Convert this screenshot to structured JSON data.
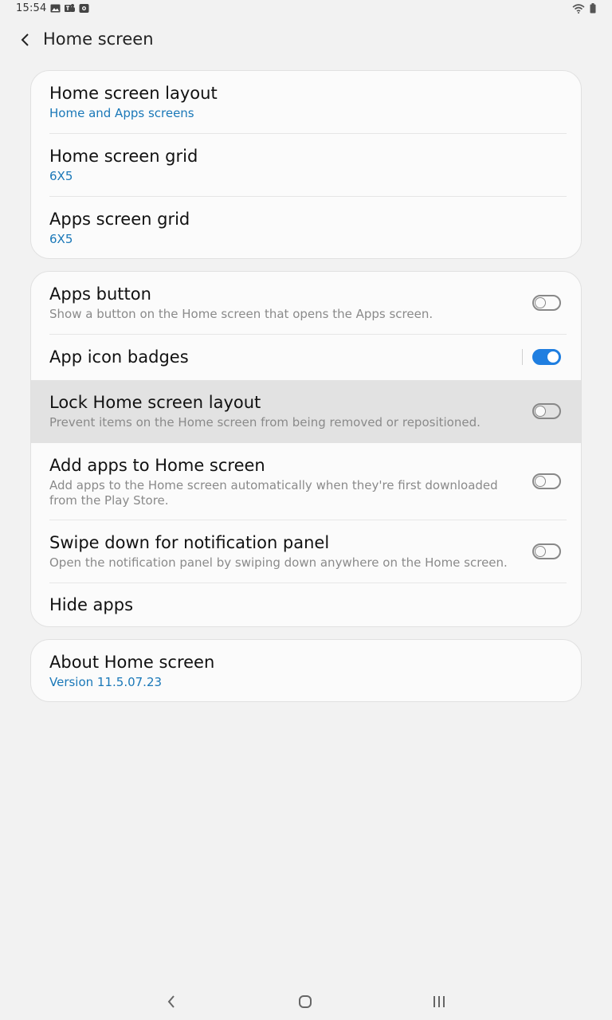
{
  "status_bar": {
    "time": "15:54",
    "notification_icons": [
      "gallery-icon",
      "teams-icon",
      "store-icon"
    ],
    "system_icons": [
      "wifi-icon",
      "battery-icon"
    ]
  },
  "header": {
    "back_icon": "chevron-left-icon",
    "title": "Home screen"
  },
  "card1": {
    "items": [
      {
        "title": "Home screen layout",
        "value": "Home and Apps screens"
      },
      {
        "title": "Home screen grid",
        "value": "6X5"
      },
      {
        "title": "Apps screen grid",
        "value": "6X5"
      }
    ]
  },
  "card2": {
    "items": [
      {
        "title": "Apps button",
        "summary": "Show a button on the Home screen that opens the Apps screen.",
        "toggle": false
      },
      {
        "title": "App icon badges",
        "toggle": true
      },
      {
        "title": "Lock Home screen layout",
        "summary": "Prevent items on the Home screen from being removed or repositioned.",
        "toggle": false,
        "highlighted": true
      },
      {
        "title": "Add apps to Home screen",
        "summary": "Add apps to the Home screen automatically when they're first downloaded from the Play Store.",
        "toggle": false
      },
      {
        "title": "Swipe down for notification panel",
        "summary": "Open the notification panel by swiping down anywhere on the Home screen.",
        "toggle": false
      },
      {
        "title": "Hide apps"
      }
    ]
  },
  "card3": {
    "items": [
      {
        "title": "About Home screen",
        "value": "Version 11.5.07.23"
      }
    ]
  },
  "nav_bar": {
    "buttons": [
      "back-icon",
      "home-icon",
      "recents-icon"
    ]
  },
  "colors": {
    "accent": "#1a78b8",
    "toggle_on": "#1f7ee0",
    "background": "#f2f2f2",
    "highlight": "#e2e2e2"
  }
}
